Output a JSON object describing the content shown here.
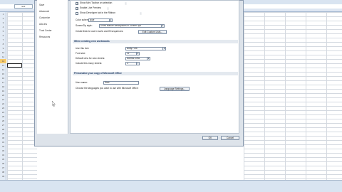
{
  "excel": {
    "name_box": "E11",
    "row_numbers": [
      "1",
      "2",
      "3",
      "4",
      "5",
      "6",
      "7",
      "8",
      "9",
      "10",
      "11",
      "12",
      "13",
      "14",
      "15",
      "16",
      "17",
      "18",
      "19",
      "20",
      "21",
      "22",
      "23",
      "24",
      "25",
      "26",
      "27",
      "28",
      "29",
      "30",
      "31",
      "32",
      "33",
      "34",
      "35",
      "36",
      "37",
      "38",
      "39"
    ],
    "selected_row": "12",
    "cell_values": [
      "1",
      "2",
      "3"
    ]
  },
  "dialog": {
    "nav_items": [
      "Save",
      "Advanced",
      "Customize",
      "Add-Ins",
      "Trust Center",
      "Resources"
    ],
    "top_options": [
      {
        "label": "Show Mini Toolbar on selection",
        "checked": true
      },
      {
        "label": "Enable Live Preview",
        "checked": true
      },
      {
        "label": "Show Developer tab in the Ribbon",
        "checked": false
      }
    ],
    "color_scheme": {
      "label": "Color scheme:",
      "value": "Blue"
    },
    "screentip": {
      "label": "ScreenTip style:",
      "value": "Show feature descriptions in ScreenTips"
    },
    "custom_lists": {
      "label": "Create lists for use in sorts and fill sequences:",
      "button": "Edit Custom Lists..."
    },
    "section_new_workbooks": "When creating new workbooks",
    "font": {
      "label": "Use this font:",
      "value": "Body Font"
    },
    "font_size": {
      "label": "Font size:",
      "value": "11"
    },
    "default_view": {
      "label": "Default view for new sheets:",
      "value": "Normal View"
    },
    "sheets": {
      "label": "Include this many sheets:",
      "value": "3"
    },
    "section_personalize": "Personalize your copy of Microsoft Office",
    "user_name": {
      "label": "User name:",
      "value": "User"
    },
    "language": {
      "label": "Choose the languages you want to use with Microsoft Office:",
      "button": "Language Settings..."
    },
    "ok_label": "OK",
    "cancel_label": "Cancel"
  },
  "colors": {
    "dialog_bg": "#dde3ea",
    "section_header": "#e4e9ef",
    "excel_header": "#dde6f2",
    "selected_row": "#f5c96a"
  }
}
